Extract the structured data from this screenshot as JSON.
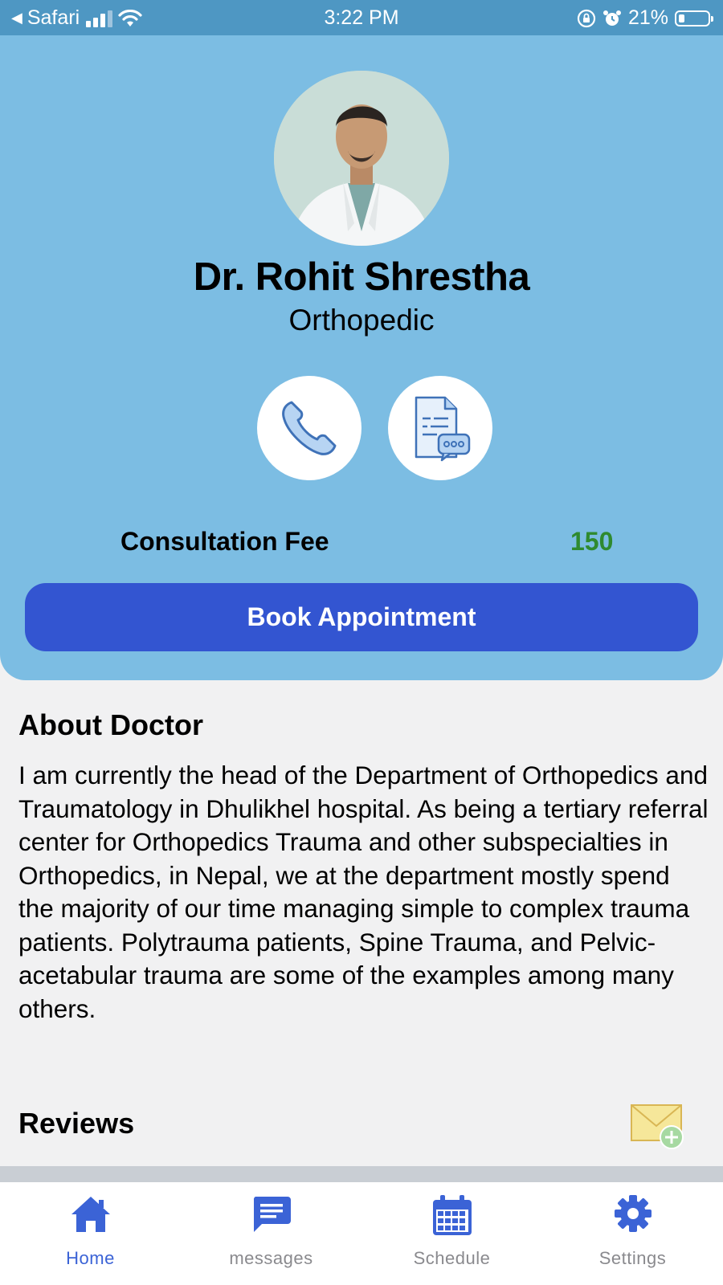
{
  "status_bar": {
    "back_app": "Safari",
    "time": "3:22 PM",
    "battery": "21%",
    "battery_level": 0.21
  },
  "doctor": {
    "name": "Dr. Rohit Shrestha",
    "specialty": "Orthopedic",
    "fee_label": "Consultation Fee",
    "fee_value": "150",
    "fee_color": "#2f8a2f"
  },
  "actions": {
    "call_icon": "phone-icon",
    "chat_icon": "document-chat-icon",
    "book_label": "Book Appointment"
  },
  "about": {
    "title": "About Doctor",
    "text": "I am currently the head of the Department of Orthopedics and Traumatology in Dhulikhel hospital. As being a tertiary referral center for Orthopedics Trauma and other subspecialties in Orthopedics, in Nepal, we at the department mostly spend the majority of our time managing simple to complex trauma patients. Polytrauma patients, Spine Trauma, and Pelvic-acetabular trauma are some of the examples among many others."
  },
  "reviews": {
    "title": "Reviews",
    "add_icon": "mail-add-icon"
  },
  "tabs": [
    {
      "label": "Home",
      "icon": "home-icon",
      "active": true
    },
    {
      "label": "messages",
      "icon": "message-icon",
      "active": false
    },
    {
      "label": "Schedule",
      "icon": "calendar-icon",
      "active": false
    },
    {
      "label": "Settings",
      "icon": "gear-icon",
      "active": false
    }
  ],
  "colors": {
    "header_bg": "#7cbde3",
    "status_bg": "#4e97c3",
    "primary": "#3355d1",
    "tab_active": "#3b63d6",
    "tab_inactive": "#8a8a8e"
  }
}
